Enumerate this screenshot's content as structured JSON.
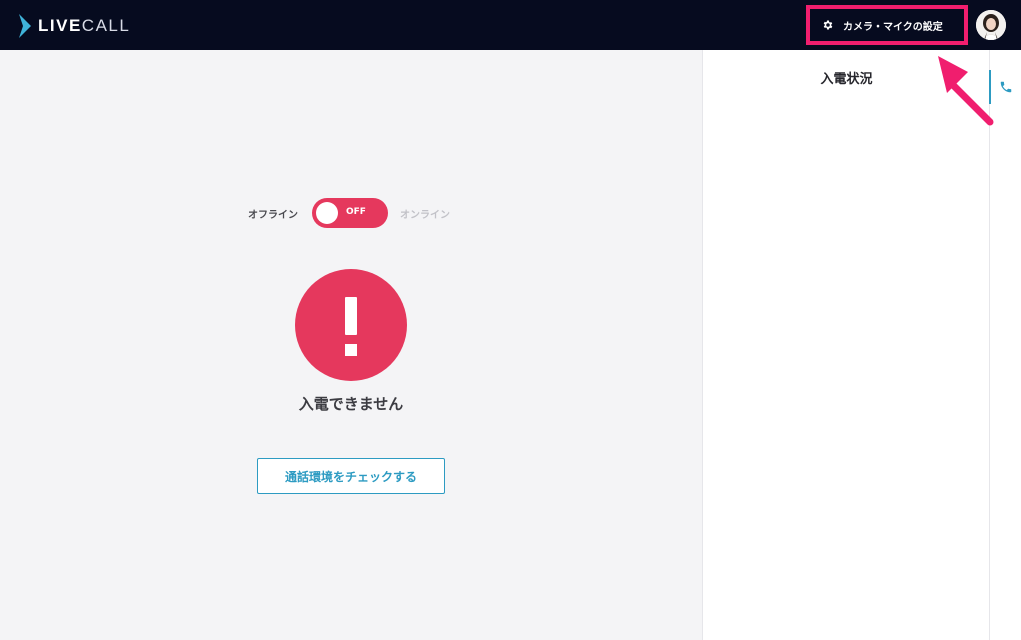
{
  "header": {
    "logo_bold": "LIVE",
    "logo_thin": "CALL",
    "settings_button_label": "カメラ・マイクの設定"
  },
  "main": {
    "toggle": {
      "offline_label": "オフライン",
      "online_label": "オンライン",
      "state_label": "OFF"
    },
    "status_text": "入電できません",
    "check_button_label": "通話環境をチェックする"
  },
  "side_panel": {
    "title": "入電状況"
  },
  "colors": {
    "header_bg": "#060b1f",
    "alert": "#e5385d",
    "accent": "#2d9bc2",
    "highlight": "#f01e6e"
  },
  "icons": {
    "logo": "chevron-logo-icon",
    "settings": "gear-icon",
    "avatar": "user-avatar",
    "alert": "exclamation-icon",
    "phone": "phone-icon"
  }
}
